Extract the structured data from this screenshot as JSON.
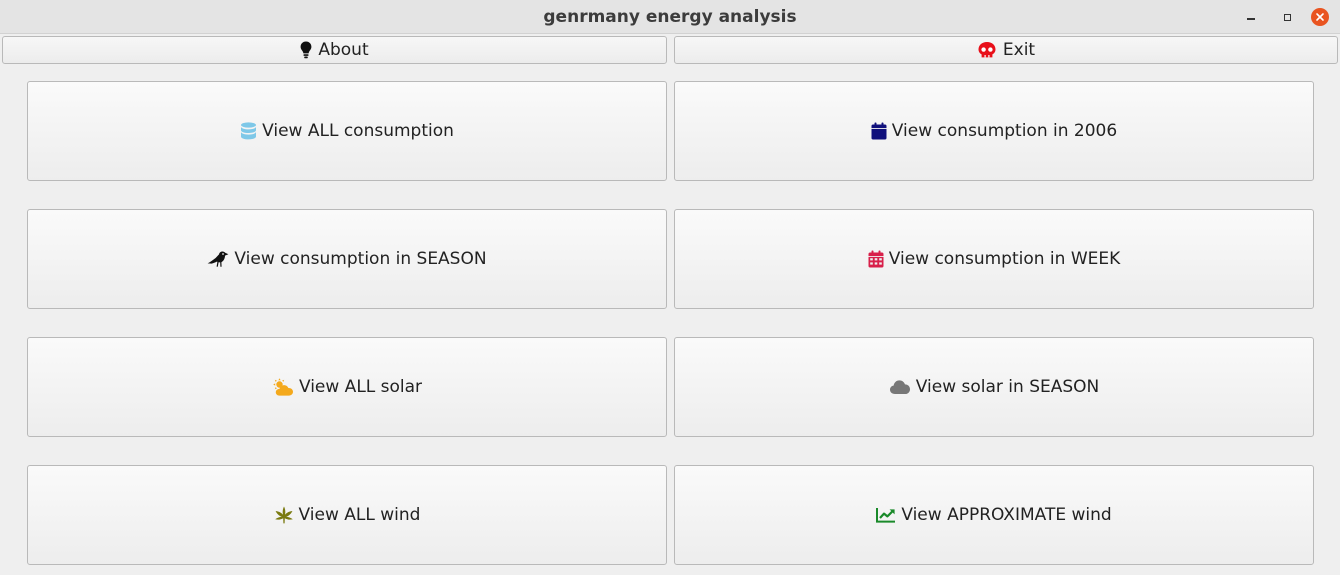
{
  "window": {
    "title": "genrmany energy analysis",
    "controls": [
      "minimize-icon",
      "maximize-icon",
      "close-icon"
    ]
  },
  "topbar": {
    "about_label": "About",
    "about_icon": "lightbulb-icon",
    "exit_label": "Exit",
    "exit_icon": "skull-icon",
    "exit_icon_color": "#e8101a"
  },
  "buttons": [
    {
      "label": "View ALL consumption",
      "icon": "database-icon",
      "color": "#7ec8e8"
    },
    {
      "label": "View consumption in 2006",
      "icon": "calendar-icon",
      "color": "#10107c"
    },
    {
      "label": "View consumption in SEASON",
      "icon": "crow-icon",
      "color": "#111111"
    },
    {
      "label": "View consumption in WEEK",
      "icon": "calendar-week-icon",
      "color": "#d8204a"
    },
    {
      "label": "View ALL solar",
      "icon": "cloud-sun-icon",
      "color": "#f4a91c"
    },
    {
      "label": "View solar in SEASON",
      "icon": "cloud-icon",
      "color": "#777777"
    },
    {
      "label": "View ALL wind",
      "icon": "leaf-icon",
      "color": "#7a7a10"
    },
    {
      "label": "View APPROXIMATE wind",
      "icon": "chart-line-icon",
      "color": "#1a8a2a"
    }
  ]
}
